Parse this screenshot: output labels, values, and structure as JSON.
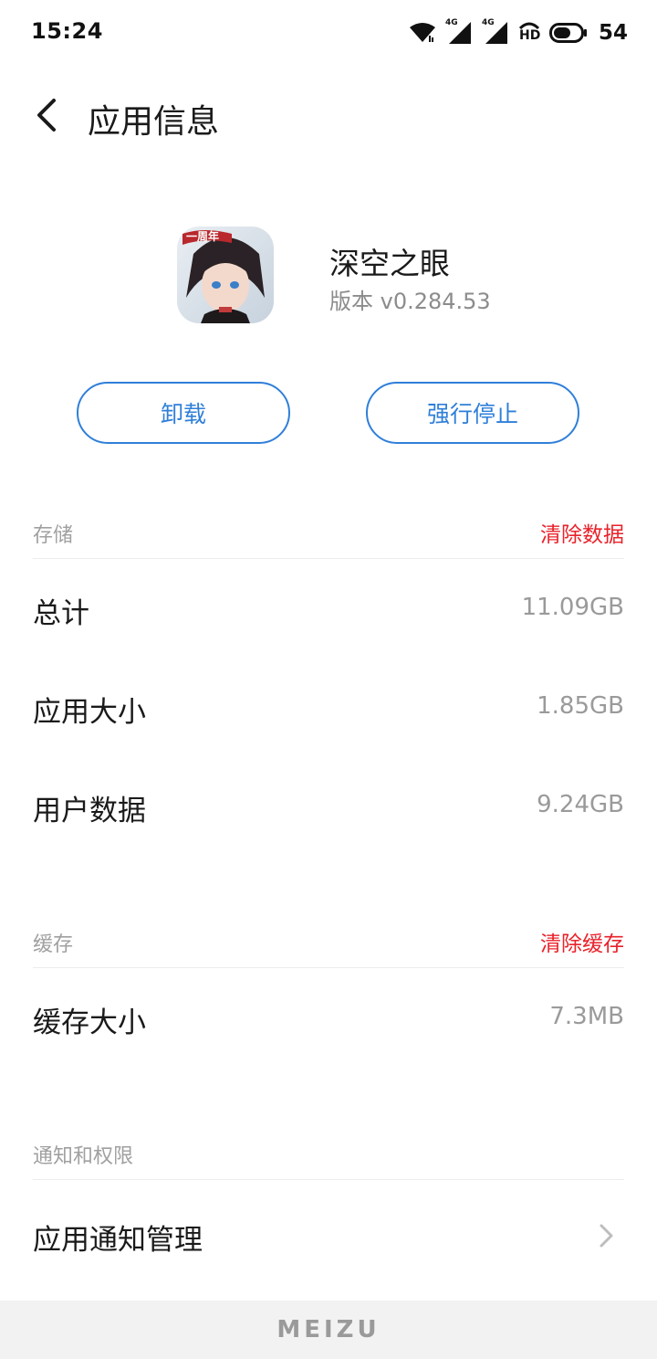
{
  "status_bar": {
    "time": "15:24",
    "battery_level": "54",
    "icons": [
      "wifi-icon",
      "signal-4g-icon",
      "signal-4g-icon",
      "hd-icon",
      "battery-icon"
    ],
    "network_labels": [
      "4G",
      "4G"
    ],
    "hd_label": "HD"
  },
  "header": {
    "title": "应用信息",
    "back_icon": "chevron-left-icon"
  },
  "app": {
    "name": "深空之眼",
    "version": "版本 v0.284.53",
    "icon_badge": "一周年"
  },
  "actions": {
    "uninstall_label": "卸载",
    "force_stop_label": "强行停止"
  },
  "storage": {
    "section_title": "存储",
    "clear_label": "清除数据",
    "rows": [
      {
        "label": "总计",
        "value": "11.09GB"
      },
      {
        "label": "应用大小",
        "value": "1.85GB"
      },
      {
        "label": "用户数据",
        "value": "9.24GB"
      }
    ]
  },
  "cache": {
    "section_title": "缓存",
    "clear_label": "清除缓存",
    "rows": [
      {
        "label": "缓存大小",
        "value": "7.3MB"
      }
    ]
  },
  "permissions": {
    "section_title": "通知和权限",
    "rows": [
      {
        "label": "应用通知管理",
        "icon": "chevron-right-icon"
      }
    ]
  },
  "footer": {
    "brand": "MEIZU"
  },
  "colors": {
    "accent_blue": "#2f7fd9",
    "danger_red": "#e8222a",
    "muted_gray": "#9a9a9a"
  }
}
